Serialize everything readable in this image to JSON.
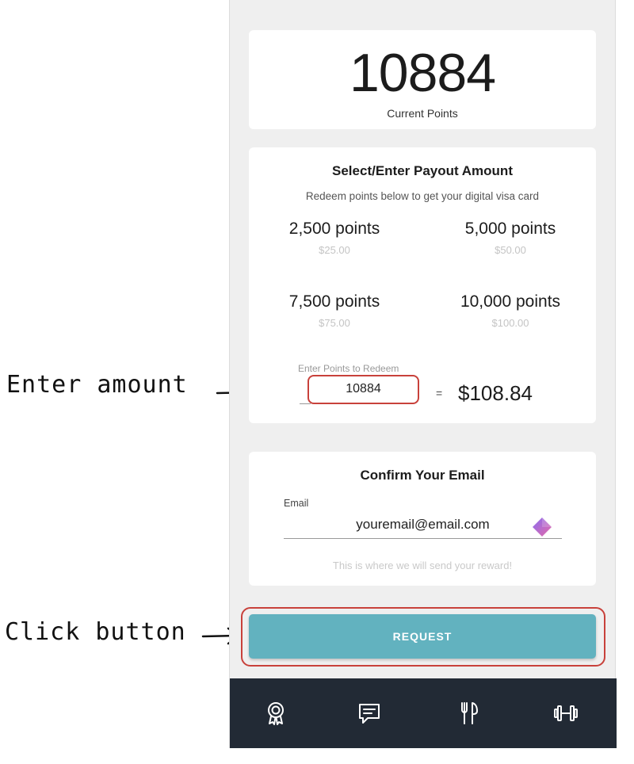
{
  "points_card": {
    "value": "10884",
    "label": "Current Points"
  },
  "payout": {
    "title": "Select/Enter Payout Amount",
    "subtitle": "Redeem points below to get your digital visa card",
    "options": [
      {
        "points": "2,500 points",
        "usd": "$25.00"
      },
      {
        "points": "5,000 points",
        "usd": "$50.00"
      },
      {
        "points": "7,500 points",
        "usd": "$75.00"
      },
      {
        "points": "10,000 points",
        "usd": "$100.00"
      }
    ],
    "enter_label": "Enter Points to Redeem",
    "enter_value": "10884",
    "equals": "=",
    "usd_result": "$108.84"
  },
  "email": {
    "title": "Confirm Your Email",
    "label": "Email",
    "value": "youremail@email.com",
    "helper": "This is where we will send your reward!"
  },
  "request_button": {
    "label": "REQUEST",
    "color": "#62b2bf"
  },
  "nav": {
    "items": [
      {
        "icon": "award-ribbon-icon"
      },
      {
        "icon": "chat-message-icon"
      },
      {
        "icon": "fork-knife-icon"
      },
      {
        "icon": "dumbbell-icon"
      }
    ],
    "background": "#222a35"
  },
  "annotations": {
    "enter_amount": "Enter amount",
    "click_button": "Click button",
    "highlight_color": "#c8413b"
  }
}
